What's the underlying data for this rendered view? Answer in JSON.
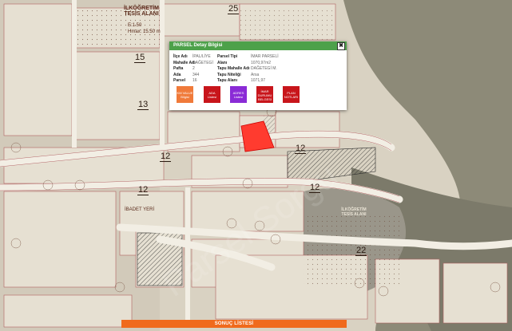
{
  "map": {
    "top_label_line1": "İLKÖĞRETİM",
    "top_label_line2": "TESİS ALANI",
    "top_label_e": "E:1.50",
    "top_label_hmax": "Hmax: 15.50 m",
    "road_25": "25",
    "road_15": "15",
    "road_13": "13",
    "road_12_a": "12",
    "road_12_b": "12",
    "road_12_c": "12",
    "road_12_d": "12",
    "road_22": "22",
    "ibadet_label": "İBADET YERİ",
    "ilkogretim_label_line1": "İLKÖĞRETİM",
    "ilkogretim_label_line2": "TESİS ALANI",
    "watermark": "Parsel Sorgu",
    "selected_parcel_color": "#ff3b2f"
  },
  "popup": {
    "title": "PARSEL Detay Bilgisi",
    "close_glyph": "✖",
    "left_col": [
      {
        "label": "İlçe Adı",
        "value": "İPAL/LİYE"
      },
      {
        "label": "Mahalle Adı",
        "value": "DAĞETEGİ"
      },
      {
        "label": "Pafta",
        "value": "2"
      },
      {
        "label": "Ada",
        "value": "344"
      },
      {
        "label": "Parsel",
        "value": "16"
      }
    ],
    "right_col": [
      {
        "label": "Parsel Tipi",
        "value": "İMAR PARSELİ"
      },
      {
        "label": "Alanı",
        "value": "1070,97m2"
      },
      {
        "label": "Tapu Mahalle Adı",
        "value": "DAĞETEGİ M."
      },
      {
        "label": "Tapu Niteliği",
        "value": "Arsa"
      },
      {
        "label": "Tapu Alanı",
        "value": "1071,97"
      }
    ],
    "buttons": [
      {
        "line1": "KM VALUE",
        "line2": "Bilgisi",
        "color": "#f07a3a"
      },
      {
        "line1": "ADA",
        "line2": "Listesi",
        "color": "#c8151b"
      },
      {
        "line1": "ADRES",
        "line2": "Listesi",
        "color": "#8a2bd6"
      },
      {
        "line1": "İMAR DURUMU",
        "line2": "BELGESİ",
        "color": "#c8151b"
      },
      {
        "line1": "PLAN",
        "line2": "NOTLARI",
        "color": "#c8151b"
      }
    ]
  },
  "results_bar": {
    "label": "SONUÇ LİSTESİ",
    "color": "#f06a1c"
  }
}
